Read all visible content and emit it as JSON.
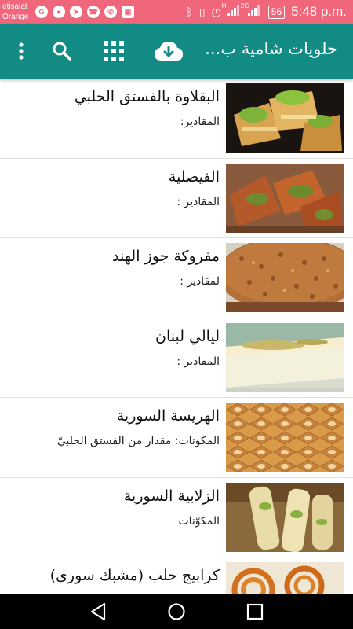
{
  "status_bar": {
    "carrier_line1": "etisalat",
    "carrier_line2": "Orange",
    "app_icons": [
      "G",
      "chrome",
      "telegram",
      "phone",
      "whatsapp",
      "gallery"
    ],
    "network_h": "H",
    "network_2g": "2G",
    "battery": "56",
    "time": "5:48 p.m."
  },
  "app_bar": {
    "title": "حلويات شامية ب...",
    "icons": [
      "download-cloud-icon",
      "grid-icon",
      "search-icon",
      "more-vert-icon"
    ]
  },
  "colors": {
    "status_bar": "#f0677c",
    "app_bar": "#138b85",
    "nav_bar": "#000000"
  },
  "recipes": [
    {
      "title": "البقلاوة بالفستق الحلبي",
      "subtitle": "المقادير:"
    },
    {
      "title": "الفيصلية",
      "subtitle": "المقادير :"
    },
    {
      "title": "مفروكة جوز الهند",
      "subtitle": "لمقادير :"
    },
    {
      "title": "ليالي لبنان",
      "subtitle": "المقادير :"
    },
    {
      "title": "الهريسة السورية",
      "subtitle": "المكونات: مقدار من الفستق الحلبيّ"
    },
    {
      "title": "الزلابية السورية",
      "subtitle": "المكوّنات"
    },
    {
      "title": "كرابيج حلب (مشبك سورى)",
      "subtitle": ""
    }
  ],
  "nav_bar": {
    "icons": [
      "back-icon",
      "home-icon",
      "recents-icon"
    ]
  }
}
